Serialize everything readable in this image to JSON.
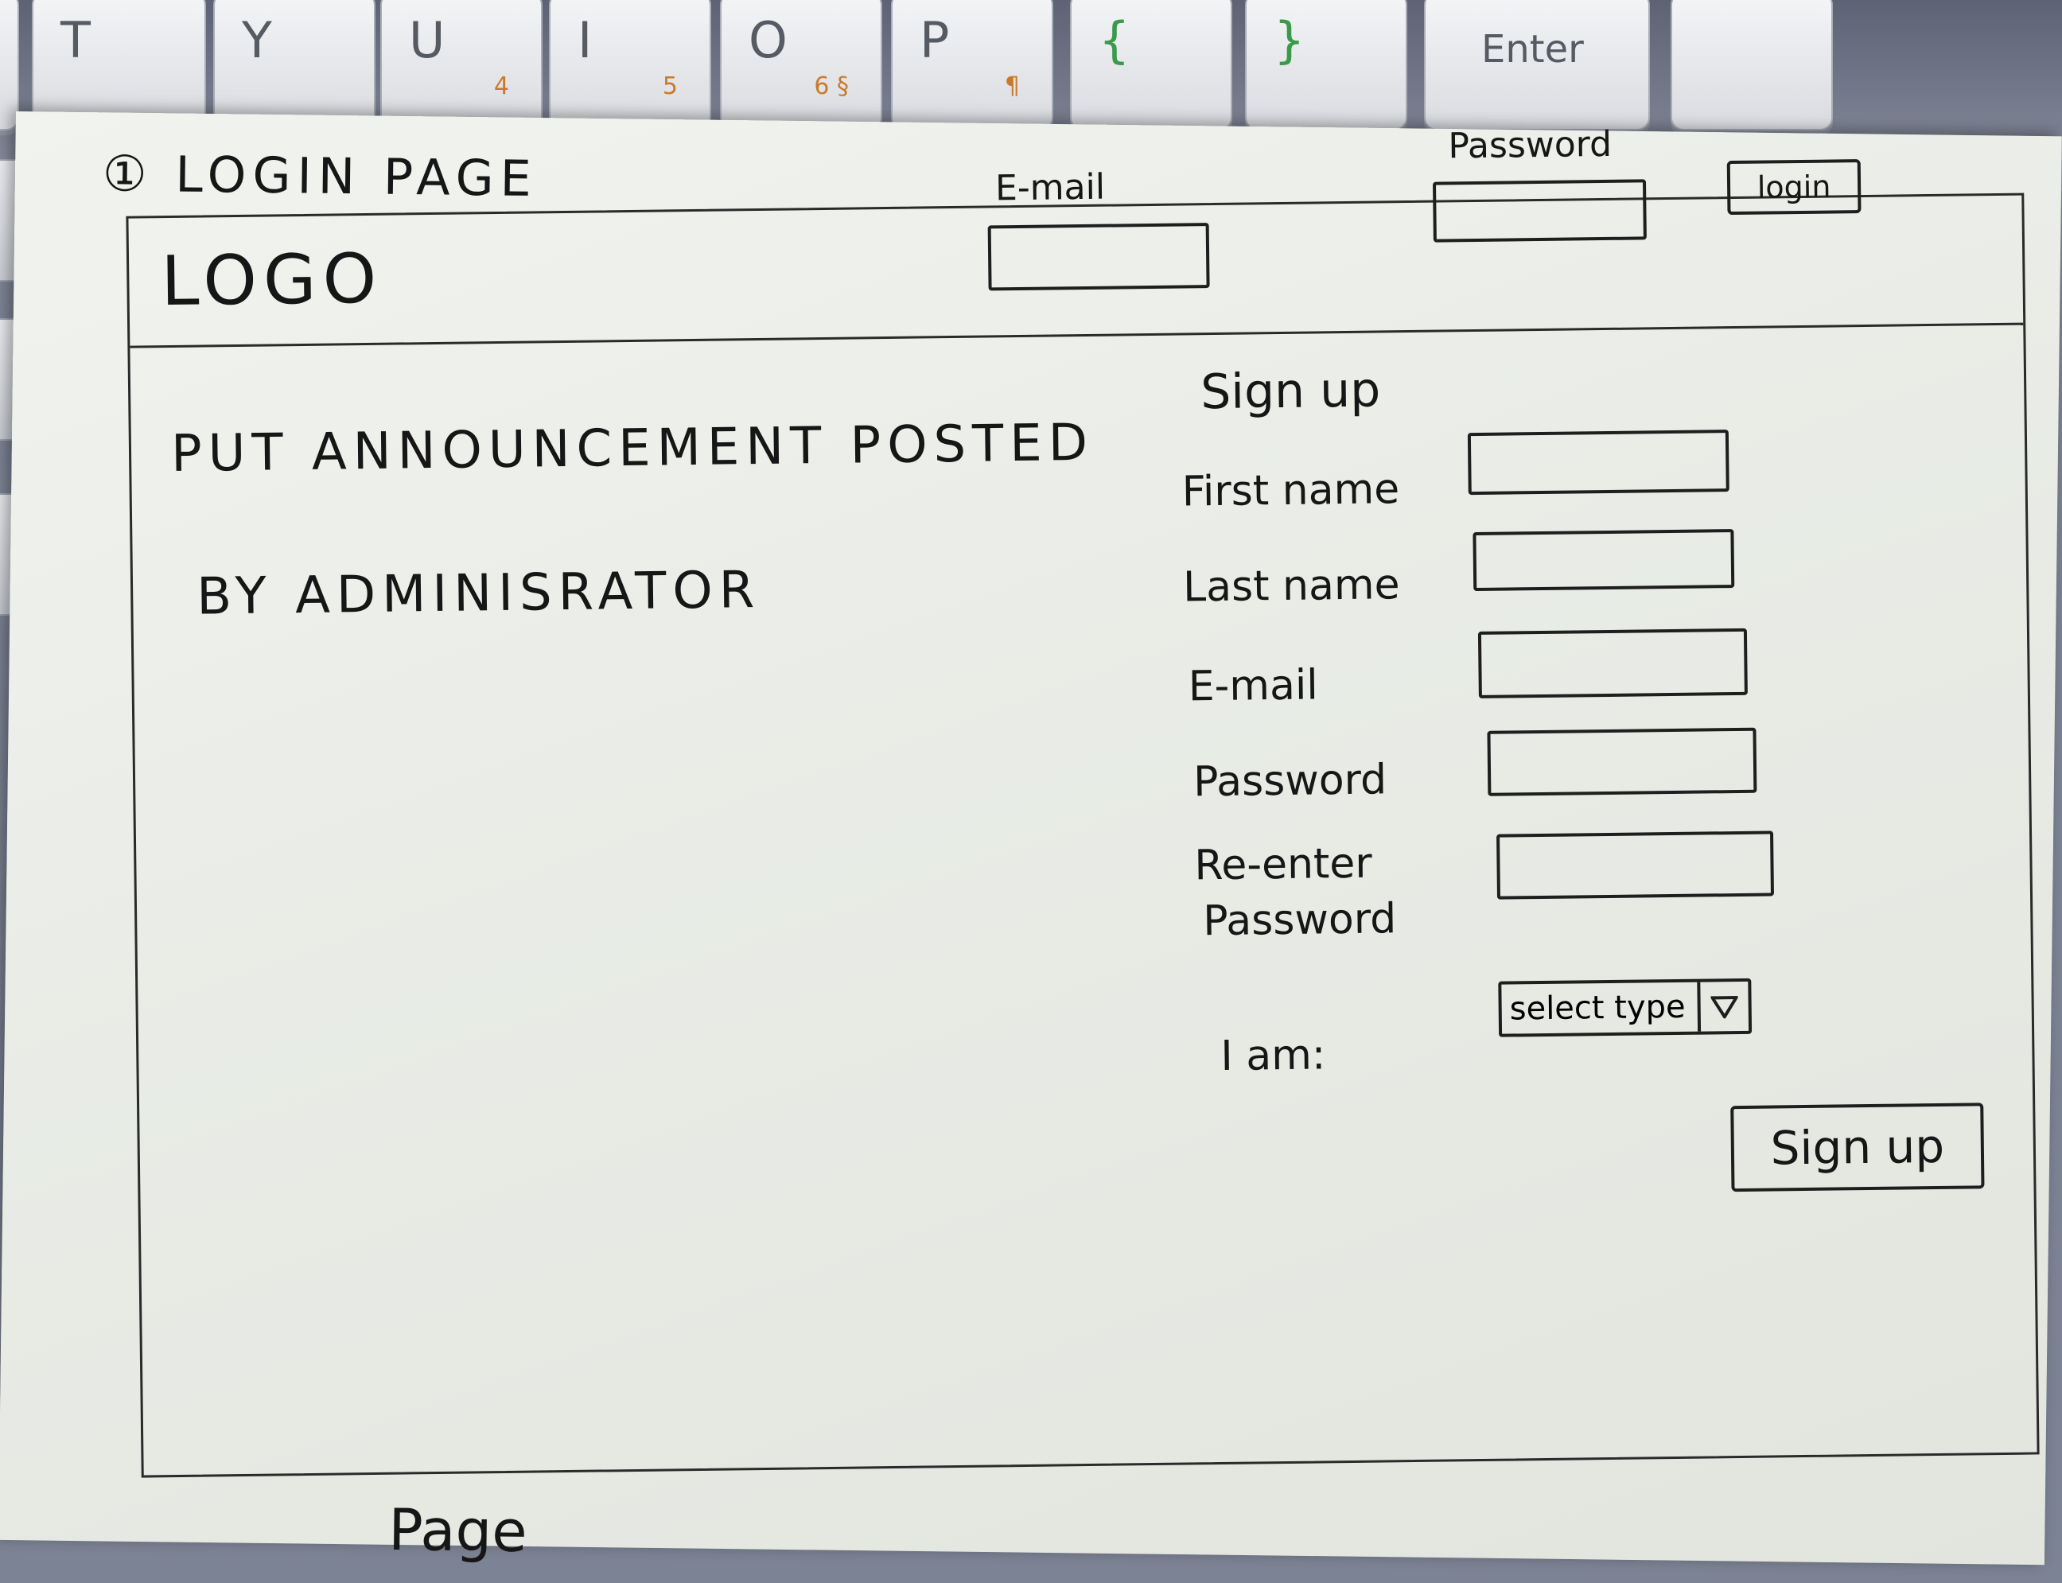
{
  "keyboard": {
    "keys": [
      {
        "glyph": "T",
        "sub": ""
      },
      {
        "glyph": "Y",
        "sub": ""
      },
      {
        "glyph": "U",
        "sub": "4"
      },
      {
        "glyph": "I",
        "sub": "5"
      },
      {
        "glyph": "O",
        "sub": "6 §"
      },
      {
        "glyph": "P",
        "sub": "¶"
      },
      {
        "glyph": "{",
        "sub": ""
      },
      {
        "glyph": "}",
        "sub": ""
      },
      {
        "glyph": "Enter",
        "sub": ""
      }
    ]
  },
  "page_label": "① LOGIN PAGE",
  "header": {
    "logo": "LOGO",
    "email_label": "E-mail",
    "password_label": "Password",
    "login_button": "login"
  },
  "announcement": {
    "line1": "PUT ANNOUNCEMENT POSTED",
    "line2": "BY ADMINISRATOR"
  },
  "signup": {
    "title": "Sign up",
    "first_name_label": "First name",
    "last_name_label": "Last name",
    "email_label": "E-mail",
    "password_label": "Password",
    "reenter_label_line1": "Re-enter",
    "reenter_label_line2": "Password",
    "i_am_label": "I am:",
    "select_value": "select type",
    "submit_button": "Sign up"
  },
  "next_page_label": "Page"
}
